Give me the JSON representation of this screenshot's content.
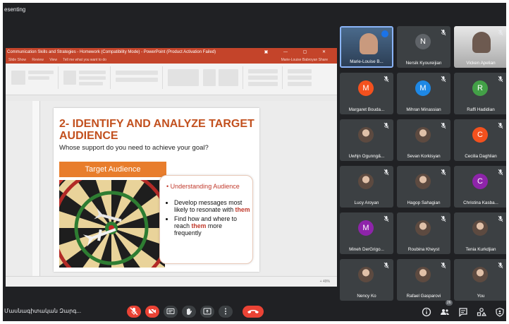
{
  "window": {
    "title": "esenting"
  },
  "ppt": {
    "title": "Communication Skills and Strategies - Homework (Compatibility Mode) - PowerPoint (Product Activation Failed)",
    "title_right": "Marie-Louise Babroyan",
    "tabs": [
      "Slide Show",
      "Review",
      "View",
      "Tell me what you want to do"
    ],
    "tabs_right": "Marie-Louise Babroyan   Share",
    "zoom": "+  49%"
  },
  "slide": {
    "title": "2- IDENTIFY AND ANALYZE TARGET AUDIENCE",
    "subtitle": "Whose support do you need to achieve your goal?",
    "box": "Target Audience",
    "heading": "Understanding Audience",
    "b1": "Develop messages most likely to resonate with ",
    "b1_hl": "them",
    "b2a": "Find how and where to reach ",
    "b2_hl": "them",
    "b2b": " more frequently"
  },
  "participants": [
    {
      "name": "Marie-Louise B...",
      "type": "video",
      "active": true
    },
    {
      "name": "Nersik Kyoureijian",
      "initial": "N",
      "color": "#5f6368"
    },
    {
      "name": "Vicken Apelian",
      "type": "video"
    },
    {
      "name": "Margaret Bouda...",
      "initial": "M",
      "color": "#f4511e"
    },
    {
      "name": "Mihran Minassian",
      "initial": "M",
      "color": "#1e88e5"
    },
    {
      "name": "Raffi Hadidian",
      "initial": "R",
      "color": "#43a047"
    },
    {
      "name": "Uwhjn Ogunng&...",
      "type": "photo"
    },
    {
      "name": "Sevan Korkisyan",
      "type": "photo"
    },
    {
      "name": "Cecilia Daghlian",
      "initial": "C",
      "color": "#f4511e"
    },
    {
      "name": "Lucy Aroyan",
      "type": "photo"
    },
    {
      "name": "Hagop Sahagian",
      "type": "photo"
    },
    {
      "name": "Christina Kasba...",
      "initial": "C",
      "color": "#8e24aa"
    },
    {
      "name": "Mineh DerGrigo...",
      "initial": "M",
      "color": "#8e24aa"
    },
    {
      "name": "Roubina Kheyst",
      "type": "photo"
    },
    {
      "name": "Tenia Kurkdjian",
      "type": "photo"
    },
    {
      "name": "Nency Ko",
      "type": "photo"
    },
    {
      "name": "Rafael Gasparovi",
      "type": "photo"
    },
    {
      "name": "You",
      "type": "photo"
    }
  ],
  "bottombar": {
    "meeting_name": "Մասնագիտական Զարգ...",
    "people_count": "26"
  },
  "colors": {
    "accent": "#c2501e",
    "red": "#ea4335"
  }
}
